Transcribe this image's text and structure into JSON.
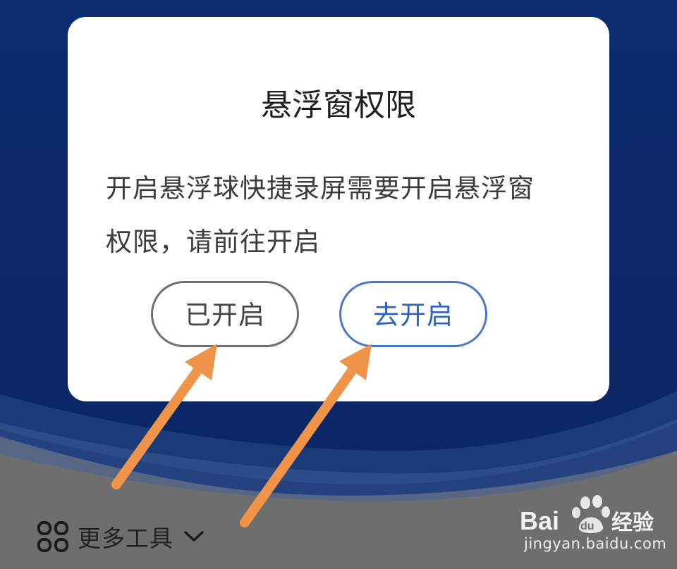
{
  "dialog": {
    "title": "悬浮窗权限",
    "message_line1": "开启悬浮球快捷录屏需要开启悬浮窗",
    "message_line2": "权限，请前往开启",
    "button_done": "已开启",
    "button_go": "去开启"
  },
  "toolbar": {
    "more_tools_label": "更多工具"
  },
  "watermark": {
    "brand": "Bai",
    "brand_du": "du",
    "brand_cn": "经验",
    "url": "jingyan.baidu.com"
  },
  "colors": {
    "background_navy": "#0c2a6b",
    "dialog_bg": "#ffffff",
    "accent_blue": "#2d62bd",
    "arrow_orange": "#f0944a",
    "bottom_gray": "#6e6e6e"
  },
  "icons": [
    "grid-icon",
    "chevron-down-icon",
    "arrow-annotation-icon"
  ]
}
